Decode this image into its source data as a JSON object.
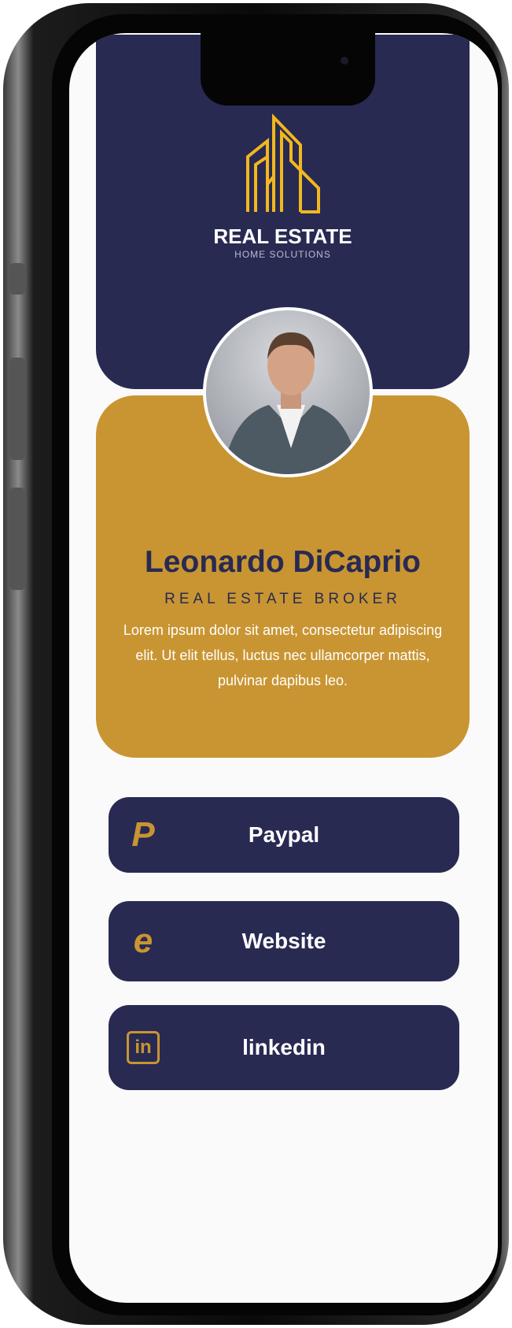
{
  "logo": {
    "title": "REAL ESTATE",
    "subtitle": "HOME SOLUTIONS"
  },
  "profile": {
    "name": "Leonardo DiCaprio",
    "role": "REAL ESTATE BROKER",
    "bio": "Lorem ipsum dolor sit amet, consectetur adipiscing elit. Ut elit tellus, luctus nec ullamcorper mattis, pulvinar dapibus leo."
  },
  "links": [
    {
      "label": "Paypal",
      "icon": "paypal-icon"
    },
    {
      "label": "Website",
      "icon": "internet-explorer-icon"
    },
    {
      "label": "linkedin",
      "icon": "linkedin-icon"
    }
  ],
  "colors": {
    "navy": "#282a52",
    "gold": "#c99532"
  }
}
